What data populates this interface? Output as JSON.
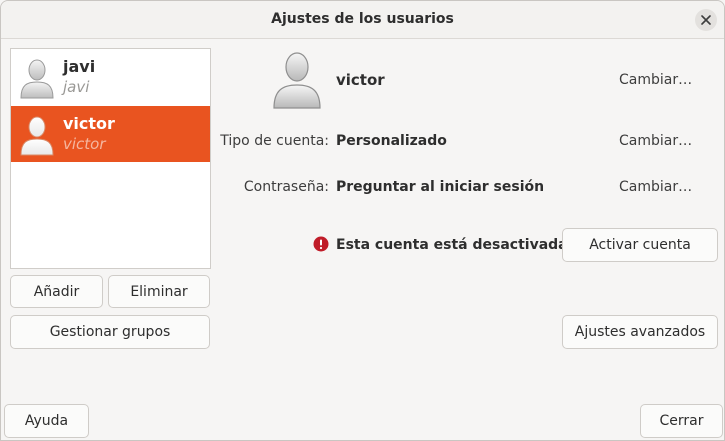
{
  "window": {
    "title": "Ajustes de los usuarios"
  },
  "users": [
    {
      "name": "javi",
      "login": "javi",
      "selected": false
    },
    {
      "name": "victor",
      "login": "victor",
      "selected": true
    }
  ],
  "sidebar": {
    "add_label": "Añadir",
    "remove_label": "Eliminar",
    "groups_label": "Gestionar grupos"
  },
  "details": {
    "user_name": "victor",
    "change_name_label": "Cambiar…",
    "account_type_label": "Tipo de cuenta:",
    "account_type_value": "Personalizado",
    "change_type_label": "Cambiar…",
    "password_label": "Contraseña:",
    "password_value": "Preguntar al iniciar sesión",
    "change_password_label": "Cambiar…",
    "disabled_message": "Esta cuenta está desactivada.",
    "activate_label": "Activar cuenta",
    "advanced_label": "Ajustes avanzados"
  },
  "footer": {
    "help_label": "Ayuda",
    "close_label": "Cerrar"
  },
  "colors": {
    "accent": "#e95420",
    "warning": "#c01c28"
  },
  "icons": [
    "close-icon",
    "user-avatar-icon",
    "error-icon"
  ]
}
